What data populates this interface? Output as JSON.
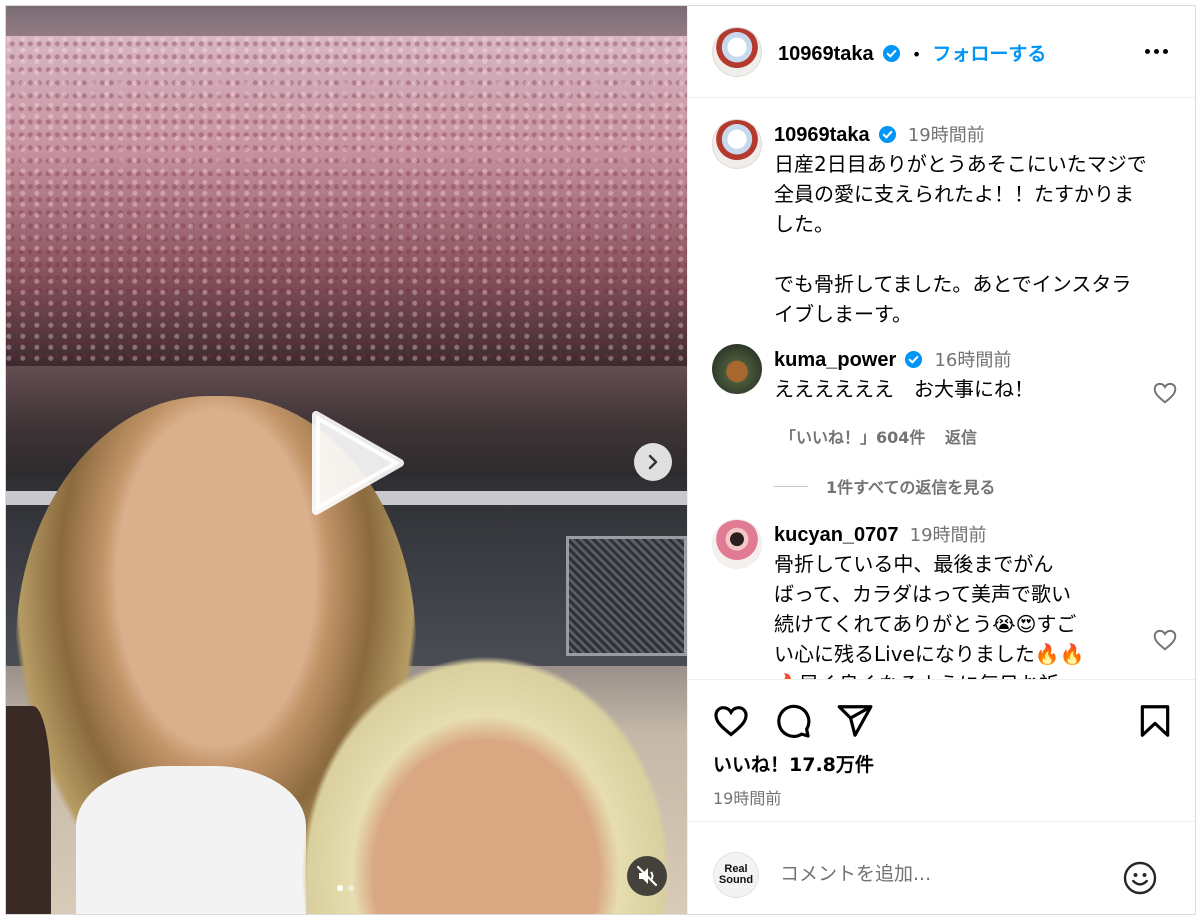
{
  "post": {
    "author": "10969taka",
    "follow_label": "フォローする",
    "separator": "•"
  },
  "caption": {
    "author": "10969taka",
    "time": "19時間前",
    "text": "日産2日目ありがとうあそこにいたマジで\n全員の愛に支えられたよ！！たすかりま\nした。\n\nでも骨折してました。あとでインスタラ\nイブしまーす。"
  },
  "comments": [
    {
      "author": "kuma_power",
      "verified": true,
      "time": "16時間前",
      "text": "ええええええ　お大事にね！",
      "likes": "「いいね！」604件",
      "reply_label": "返信",
      "view_replies": "1件すべての返信を見る"
    },
    {
      "author": "kucyan_0707",
      "verified": false,
      "time": "19時間前",
      "text": "骨折している中、最後までがん\nばって、カラダはって美声で歌い\n続けてくれてありがとう😭😍すご\nい心に残るLiveになりました🔥🔥\n🔥早く良くなるように毎日お祈"
    }
  ],
  "footer": {
    "likes": "いいね！17.8万件",
    "time": "19時間前",
    "comment_placeholder": "コメントを追加...",
    "brand_logo": "Real\nSound"
  },
  "icons": {
    "verified_color": "#0095f6",
    "accent": "#0095f6"
  }
}
